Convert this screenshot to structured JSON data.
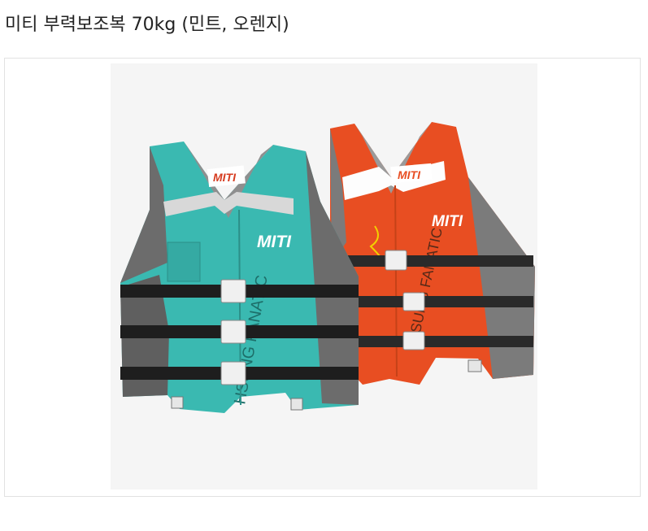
{
  "product": {
    "title": "미티 부력보조복 70kg (민트, 오렌지)"
  },
  "image": {
    "subject": "two life vests",
    "brand_logo_text": "MITI",
    "side_text": "HSUNG FANATIC",
    "colors": {
      "mint": "#3ab9b1",
      "orange": "#f05a28",
      "gray": "#6c6c6c",
      "strap": "#1e1e1e"
    }
  }
}
